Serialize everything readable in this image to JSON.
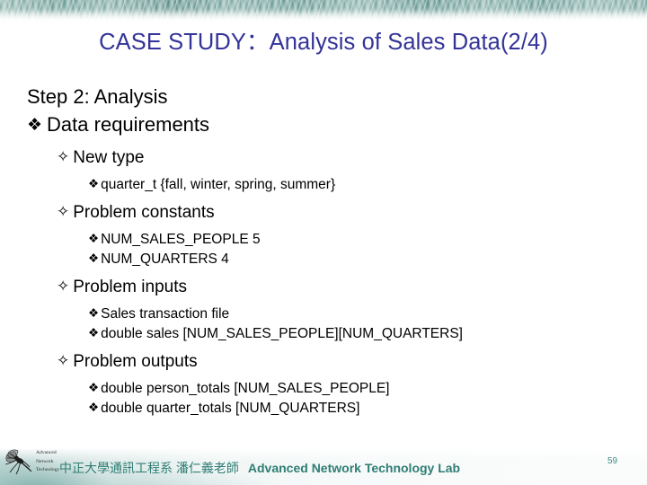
{
  "slide": {
    "title": "CASE STUDY：Analysis of Sales Data(2/4)",
    "title_color": "#333399",
    "accent_color": "#2e7d74",
    "page_number": "59"
  },
  "outline": [
    {
      "level": 1,
      "bullet": "",
      "text": "Step 2: Analysis",
      "name": "outline-step-heading"
    },
    {
      "level": 2,
      "bullet": "❖",
      "bullet_name": "diamond-cluster-bullet-icon",
      "text": "Data requirements",
      "name": "outline-data-requirements"
    },
    {
      "level": 3,
      "bullet": "✧",
      "bullet_name": "star-outline-bullet-icon",
      "text": "New type",
      "name": "outline-new-type"
    },
    {
      "level": 4,
      "bullet": "❖",
      "bullet_name": "diamond-cluster-bullet-icon",
      "text": "quarter_t  {fall, winter, spring, summer}",
      "name": "outline-quarter-t"
    },
    {
      "level": 3,
      "bullet": "✧",
      "bullet_name": "star-outline-bullet-icon",
      "text": "Problem constants",
      "name": "outline-problem-constants"
    },
    {
      "level": 4,
      "bullet": "❖",
      "bullet_name": "diamond-cluster-bullet-icon",
      "text": "NUM_SALES_PEOPLE  5",
      "name": "outline-num-sales-people"
    },
    {
      "level": 4,
      "bullet": "❖",
      "bullet_name": "diamond-cluster-bullet-icon",
      "text": "NUM_QUARTERS          4",
      "name": "outline-num-quarters"
    },
    {
      "level": 3,
      "bullet": "✧",
      "bullet_name": "star-outline-bullet-icon",
      "text": "Problem inputs",
      "name": "outline-problem-inputs"
    },
    {
      "level": 4,
      "bullet": "❖",
      "bullet_name": "diamond-cluster-bullet-icon",
      "text": "Sales transaction file",
      "name": "outline-sales-transaction-file"
    },
    {
      "level": 4,
      "bullet": "❖",
      "bullet_name": "diamond-cluster-bullet-icon",
      "text": "double sales [NUM_SALES_PEOPLE][NUM_QUARTERS]",
      "name": "outline-double-sales"
    },
    {
      "level": 3,
      "bullet": "✧",
      "bullet_name": "star-outline-bullet-icon",
      "text": "Problem outputs",
      "name": "outline-problem-outputs"
    },
    {
      "level": 4,
      "bullet": "❖",
      "bullet_name": "diamond-cluster-bullet-icon",
      "text": "double person_totals [NUM_SALES_PEOPLE]",
      "name": "outline-double-person-totals"
    },
    {
      "level": 4,
      "bullet": "❖",
      "bullet_name": "diamond-cluster-bullet-icon",
      "text": "double quarter_totals [NUM_QUARTERS]",
      "name": "outline-double-quarter-totals"
    }
  ],
  "footer": {
    "logo_line1": "Advanced",
    "logo_line2": "Network",
    "logo_line3": "Technology",
    "affiliation": "中正大學通訊工程系 潘仁義老師",
    "lab": "Advanced Network Technology Lab"
  }
}
